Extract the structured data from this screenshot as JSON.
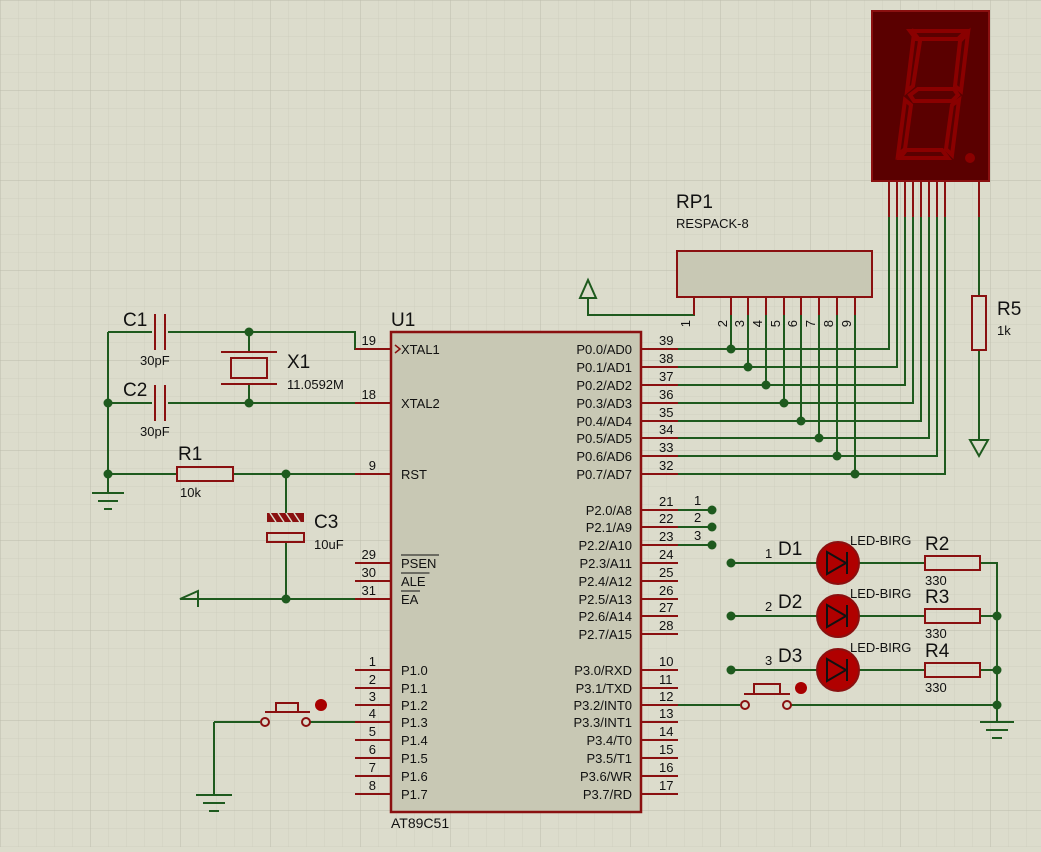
{
  "mcu": {
    "ref": "U1",
    "part": "AT89C51",
    "left_pins": [
      {
        "num": "19",
        "name": "XTAL1"
      },
      {
        "num": "18",
        "name": "XTAL2"
      },
      {
        "num": "9",
        "name": "RST"
      },
      {
        "num": "29",
        "name": "PSEN"
      },
      {
        "num": "30",
        "name": "ALE"
      },
      {
        "num": "31",
        "name": "EA"
      },
      {
        "num": "1",
        "name": "P1.0"
      },
      {
        "num": "2",
        "name": "P1.1"
      },
      {
        "num": "3",
        "name": "P1.2"
      },
      {
        "num": "4",
        "name": "P1.3"
      },
      {
        "num": "5",
        "name": "P1.4"
      },
      {
        "num": "6",
        "name": "P1.5"
      },
      {
        "num": "7",
        "name": "P1.6"
      },
      {
        "num": "8",
        "name": "P1.7"
      }
    ],
    "right_pins": [
      {
        "num": "39",
        "name": "P0.0/AD0"
      },
      {
        "num": "38",
        "name": "P0.1/AD1"
      },
      {
        "num": "37",
        "name": "P0.2/AD2"
      },
      {
        "num": "36",
        "name": "P0.3/AD3"
      },
      {
        "num": "35",
        "name": "P0.4/AD4"
      },
      {
        "num": "34",
        "name": "P0.5/AD5"
      },
      {
        "num": "33",
        "name": "P0.6/AD6"
      },
      {
        "num": "32",
        "name": "P0.7/AD7"
      },
      {
        "num": "21",
        "name": "P2.0/A8"
      },
      {
        "num": "22",
        "name": "P2.1/A9"
      },
      {
        "num": "23",
        "name": "P2.2/A10"
      },
      {
        "num": "24",
        "name": "P2.3/A11"
      },
      {
        "num": "25",
        "name": "P2.4/A12"
      },
      {
        "num": "26",
        "name": "P2.5/A13"
      },
      {
        "num": "27",
        "name": "P2.6/A14"
      },
      {
        "num": "28",
        "name": "P2.7/A15"
      },
      {
        "num": "10",
        "name": "P3.0/RXD"
      },
      {
        "num": "11",
        "name": "P3.1/TXD"
      },
      {
        "num": "12",
        "name": "P3.2/INT0"
      },
      {
        "num": "13",
        "name": "P3.3/INT1"
      },
      {
        "num": "14",
        "name": "P3.4/T0"
      },
      {
        "num": "15",
        "name": "P3.5/T1"
      },
      {
        "num": "16",
        "name": "P3.6/WR"
      },
      {
        "num": "17",
        "name": "P3.7/RD"
      }
    ]
  },
  "c1": {
    "ref": "C1",
    "value": "30pF"
  },
  "c2": {
    "ref": "C2",
    "value": "30pF"
  },
  "x1": {
    "ref": "X1",
    "value": "11.0592M"
  },
  "r1": {
    "ref": "R1",
    "value": "10k"
  },
  "c3": {
    "ref": "C3",
    "value": "10uF"
  },
  "rp1": {
    "ref": "RP1",
    "value": "RESPACK-8",
    "pin_labels": [
      "1",
      "2",
      "3",
      "4",
      "5",
      "6",
      "7",
      "8",
      "9"
    ]
  },
  "r5": {
    "ref": "R5",
    "value": "1k"
  },
  "leds": [
    {
      "ref": "D1",
      "value": "LED-BIRG",
      "net": "1"
    },
    {
      "ref": "D2",
      "value": "LED-BIRG",
      "net": "2"
    },
    {
      "ref": "D3",
      "value": "LED-BIRG",
      "net": "3"
    }
  ],
  "led_resistors": [
    {
      "ref": "R2",
      "value": "330"
    },
    {
      "ref": "R3",
      "value": "330"
    },
    {
      "ref": "R4",
      "value": "330"
    }
  ],
  "p2_nets": [
    "1",
    "2",
    "3"
  ],
  "colors": {
    "wire": "#1e5a1e",
    "part": "#8a1010",
    "body": "#c8c8b4",
    "grid": "#c8c8b8",
    "led": "#b00000",
    "display": "#5a0000"
  }
}
